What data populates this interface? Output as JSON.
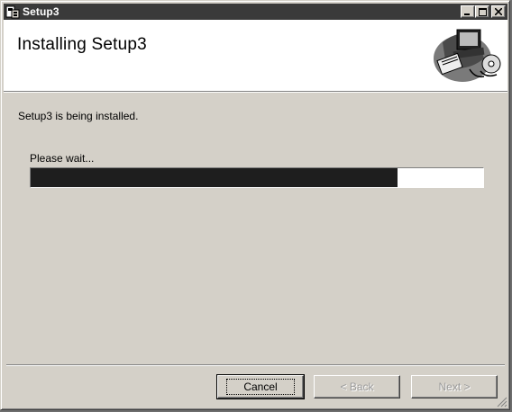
{
  "window": {
    "title": "Setup3",
    "controls": {
      "minimize": "_",
      "maximize": "□",
      "close": "×"
    }
  },
  "header": {
    "title": "Installing Setup3",
    "graphic": "computer-with-disc-icon"
  },
  "body": {
    "status": "Setup3 is being installed.",
    "wait_label": "Please wait...",
    "progress": 0.81
  },
  "buttons": {
    "cancel": "Cancel",
    "back": "< Back",
    "next": "Next >"
  },
  "colors": {
    "titlebar": "#3a3a3a",
    "face": "#d4d0c8",
    "progress_fill": "#1e1e1e"
  }
}
